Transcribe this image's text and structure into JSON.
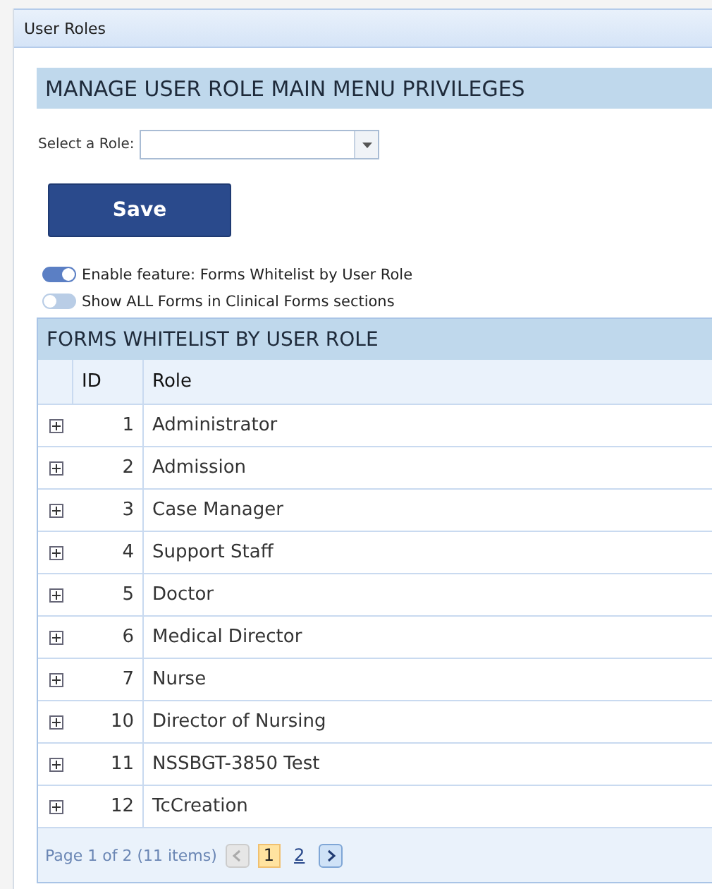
{
  "panel": {
    "title": "User Roles"
  },
  "section_title": "MANAGE USER ROLE MAIN MENU PRIVILEGES",
  "role_select": {
    "label": "Select a Role:"
  },
  "save_button": "Save",
  "toggles": [
    {
      "label": "Enable feature: Forms Whitelist by User Role",
      "on": true
    },
    {
      "label": "Show ALL Forms in Clinical Forms sections",
      "on": false
    }
  ],
  "grid": {
    "title": "FORMS WHITELIST BY USER ROLE",
    "columns": [
      "ID",
      "Role"
    ],
    "rows": [
      {
        "id": "1",
        "role": "Administrator"
      },
      {
        "id": "2",
        "role": "Admission"
      },
      {
        "id": "3",
        "role": "Case Manager"
      },
      {
        "id": "4",
        "role": "Support Staff"
      },
      {
        "id": "5",
        "role": "Doctor"
      },
      {
        "id": "6",
        "role": "Medical Director"
      },
      {
        "id": "7",
        "role": "Nurse"
      },
      {
        "id": "10",
        "role": "Director of Nursing"
      },
      {
        "id": "11",
        "role": "NSSBGT-3850 Test"
      },
      {
        "id": "12",
        "role": "TcCreation"
      }
    ],
    "pager": {
      "summary": "Page 1 of 2 (11 items)",
      "prev_disabled": true,
      "next_disabled": false,
      "pages": [
        {
          "label": "1",
          "selected": true
        },
        {
          "label": "2",
          "selected": false
        }
      ]
    }
  }
}
